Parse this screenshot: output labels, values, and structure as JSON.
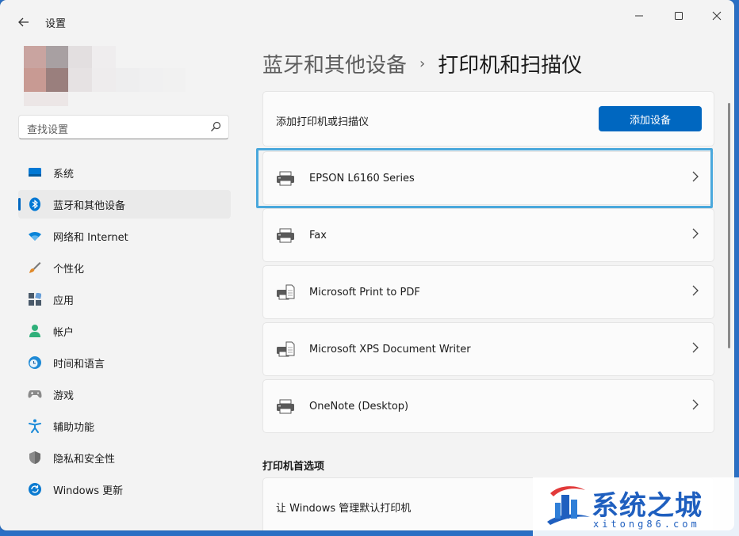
{
  "window": {
    "title": "设置"
  },
  "search": {
    "placeholder": "查找设置"
  },
  "sidebar": {
    "items": [
      {
        "label": "系统",
        "icon": "monitor-icon",
        "color": "#0078d4"
      },
      {
        "label": "蓝牙和其他设备",
        "icon": "bluetooth-icon",
        "color": "#0078d4",
        "active": true
      },
      {
        "label": "网络和 Internet",
        "icon": "wifi-icon",
        "color": "#0a84d8"
      },
      {
        "label": "个性化",
        "icon": "brush-icon",
        "color": "#e08a2a"
      },
      {
        "label": "应用",
        "icon": "apps-icon",
        "color": "#4a5a6a"
      },
      {
        "label": "帐户",
        "icon": "person-icon",
        "color": "#2fb07a"
      },
      {
        "label": "时间和语言",
        "icon": "clock-globe-icon",
        "color": "#1f8ad6"
      },
      {
        "label": "游戏",
        "icon": "gamepad-icon",
        "color": "#7a7a7a"
      },
      {
        "label": "辅助功能",
        "icon": "accessibility-icon",
        "color": "#1a8ad8"
      },
      {
        "label": "隐私和安全性",
        "icon": "shield-icon",
        "color": "#6b6b6b"
      },
      {
        "label": "Windows 更新",
        "icon": "update-icon",
        "color": "#0a7ad0"
      }
    ]
  },
  "breadcrumb": {
    "parent": "蓝牙和其他设备",
    "separator": "›",
    "current": "打印机和扫描仪"
  },
  "add": {
    "label": "添加打印机或扫描仪",
    "button": "添加设备"
  },
  "printers": [
    {
      "name": "EPSON L6160 Series",
      "icon": "printer-icon"
    },
    {
      "name": "Fax",
      "icon": "printer-icon"
    },
    {
      "name": "Microsoft Print to PDF",
      "icon": "printer-document-icon"
    },
    {
      "name": "Microsoft XPS Document Writer",
      "icon": "printer-document-icon"
    },
    {
      "name": "OneNote (Desktop)",
      "icon": "printer-icon"
    }
  ],
  "preferences": {
    "title": "打印机首选项",
    "default_label": "让 Windows 管理默认打印机"
  },
  "watermark": {
    "title": "系统之城",
    "subtitle": "xitong86.com"
  },
  "colors": {
    "accent": "#0067c0",
    "highlight": "#4aa8dc"
  }
}
